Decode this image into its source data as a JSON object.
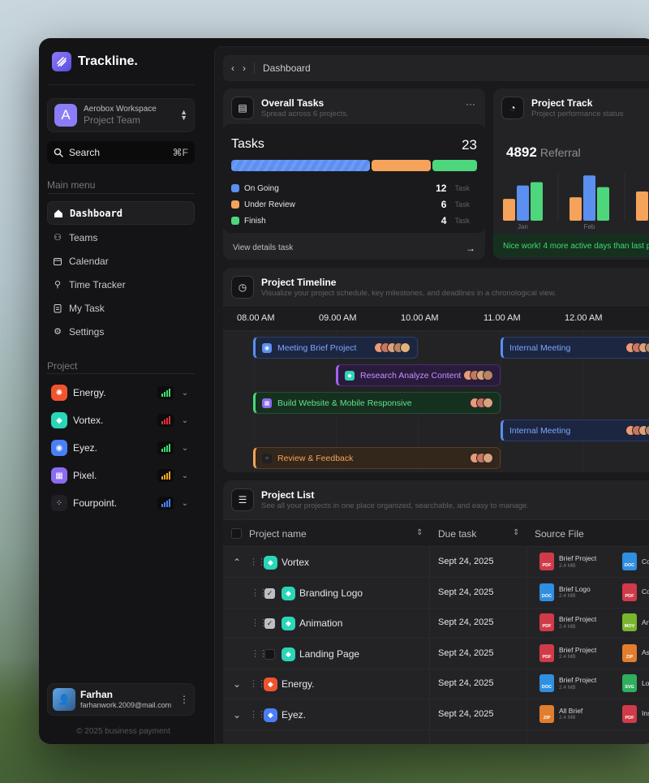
{
  "app": {
    "name": "Trackline."
  },
  "workspace": {
    "initial": "A",
    "title": "Aerobox Workspace",
    "subtitle": "Project Team"
  },
  "search": {
    "label": "Search",
    "shortcut": "⌘F"
  },
  "menu": {
    "heading": "Main menu",
    "items": [
      {
        "label": "Dashboard",
        "icon": "home-icon",
        "active": true
      },
      {
        "label": "Teams",
        "icon": "users-icon"
      },
      {
        "label": "Calendar",
        "icon": "calendar-icon"
      },
      {
        "label": "Time Tracker",
        "icon": "user-clock-icon"
      },
      {
        "label": "My Task",
        "icon": "clipboard-icon"
      },
      {
        "label": "Settings",
        "icon": "gear-icon"
      }
    ]
  },
  "projects": {
    "heading": "Project",
    "items": [
      {
        "label": "Energy.",
        "color": "#f0542f",
        "signal_color": "#3ddc6f"
      },
      {
        "label": "Vortex.",
        "color": "#2ad6b8",
        "signal_color": "#e0303c"
      },
      {
        "label": "Eyez.",
        "color": "#4a7ff5",
        "signal_color": "#3ddc6f"
      },
      {
        "label": "Pixel.",
        "color": "#8b6cf0",
        "signal_color": "#f5a623"
      },
      {
        "label": "Fourpoint.",
        "color": "#1b1b20",
        "signal_color": "#4a7ff5"
      }
    ]
  },
  "user": {
    "name": "Farhan",
    "email": "farhanwork.2009@mail.com"
  },
  "footer": "© 2025 business payment",
  "breadcrumb": {
    "page": "Dashboard"
  },
  "overall_tasks": {
    "title": "Overall Tasks",
    "subtitle": "Spread across 6 projects.",
    "label": "Tasks",
    "total": "23",
    "rows": [
      {
        "label": "On Going",
        "count": "12",
        "unit": "Task",
        "color": "#5b8ff0"
      },
      {
        "label": "Under Review",
        "count": "6",
        "unit": "Task",
        "color": "#f5a25a"
      },
      {
        "label": "Finish",
        "count": "4",
        "unit": "Task",
        "color": "#4ed67c"
      }
    ],
    "footer": "View details task"
  },
  "project_track": {
    "title": "Project Track",
    "subtitle": "Project performance status",
    "value": "4892",
    "value_label": "Referral",
    "months": [
      "Jan",
      "Feb"
    ],
    "note": "Nice work! 4 more active days than last p"
  },
  "chart_data": {
    "type": "bar",
    "categories": [
      "Jan",
      "Feb"
    ],
    "series": [
      {
        "values": [
          26,
          28
        ],
        "color": "#f5a25a"
      },
      {
        "values": [
          42,
          54
        ],
        "color": "#5b8ff0"
      },
      {
        "values": [
          46,
          40
        ],
        "color": "#4ed67c"
      }
    ],
    "title": "",
    "xlabel": "",
    "ylabel": ""
  },
  "timeline": {
    "title": "Project Timeline",
    "subtitle": "Visualize your project schedule, key milestones, and deadlines in a chronological view.",
    "times": [
      "08.00 AM",
      "09.00 AM",
      "10.00 AM",
      "11.00 AM",
      "12.00 AM"
    ],
    "events": [
      {
        "label": "Meeting Brief Project",
        "color": "#5b8ff0",
        "text_color": "#7ea6ff",
        "bg": "#1c2640"
      },
      {
        "label": "Internal Meeting",
        "color": "#5b8ff0",
        "text_color": "#7ea6ff",
        "bg": "#1c2640"
      },
      {
        "label": "Research Analyze Content",
        "color": "#a461f0",
        "text_color": "#c493ff",
        "bg": "#2a1b3d"
      },
      {
        "label": "Build Website & Mobile Responsive",
        "color": "#4ed67c",
        "text_color": "#63e08d",
        "bg": "#16301f"
      },
      {
        "label": "Internal Meeting",
        "color": "#5b8ff0",
        "text_color": "#7ea6ff",
        "bg": "#1c2640"
      },
      {
        "label": "Review & Feedback",
        "color": "#f5a25a",
        "text_color": "#f5a25a",
        "bg": "#33261a"
      }
    ]
  },
  "project_list": {
    "title": "Project List",
    "subtitle": "See all your projects in one place organized, searchable, and easy to manage.",
    "columns": [
      "Project name",
      "Due task",
      "Source File"
    ],
    "rows": [
      {
        "name": "Vortex",
        "due": "Sept 24, 2025",
        "color": "#2ad6b8",
        "file1": "Brief Project",
        "size1": "2.4 MB",
        "type1": "PDF",
        "file2": "Co",
        "type2": "DOC"
      },
      {
        "name": "Branding Logo",
        "due": "Sept 24, 2025",
        "color": "#2ad6b8",
        "checked": true,
        "file1": "Brief Logo",
        "size1": "2.4 MB",
        "type1": "DOC",
        "file2": "Co",
        "type2": "PDF"
      },
      {
        "name": "Animation",
        "due": "Sept 24, 2025",
        "color": "#2ad6b8",
        "checked": true,
        "file1": "Brief Project",
        "size1": "2.4 MB",
        "type1": "PDF",
        "file2": "An",
        "type2": "MOV"
      },
      {
        "name": "Landing Page",
        "due": "Sept 24, 2025",
        "color": "#2ad6b8",
        "checked": false,
        "file1": "Brief Project",
        "size1": "2.4 MB",
        "type1": "PDF",
        "file2": "As",
        "type2": "ZIP"
      },
      {
        "name": "Energy.",
        "due": "Sept 24, 2025",
        "color": "#f0542f",
        "file1": "Brief Project",
        "size1": "2.4 MB",
        "type1": "DOC",
        "file2": "Lo",
        "type2": "SVG"
      },
      {
        "name": "Eyez.",
        "due": "Sept 24, 2025",
        "color": "#4a7ff5",
        "file1": "All Brief",
        "size1": "2.4 MB",
        "type1": "ZIP",
        "file2": "Ins",
        "type2": "PDF"
      }
    ]
  }
}
